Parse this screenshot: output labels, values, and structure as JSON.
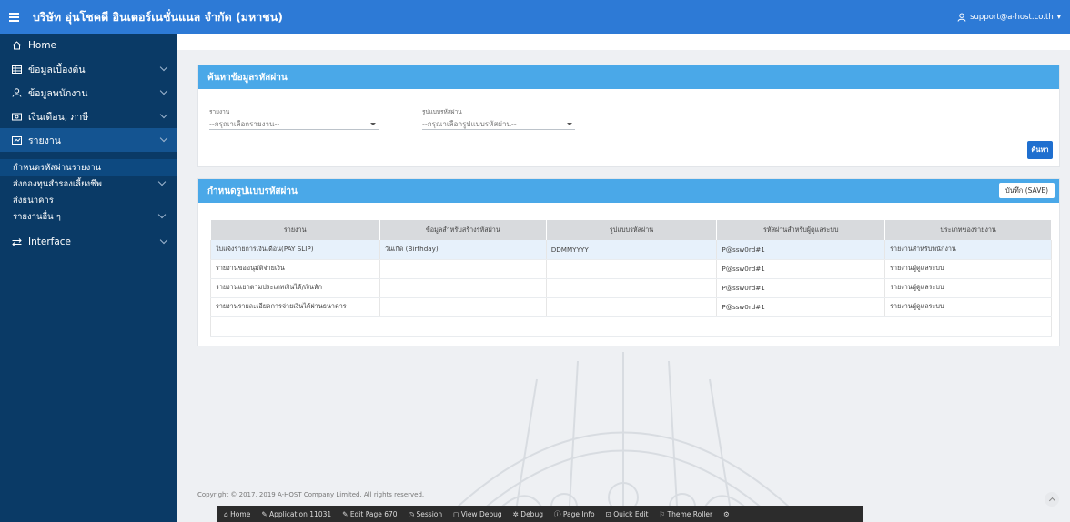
{
  "header": {
    "title": "บริษัท อุ่นโชคดี อินเตอร์เนชั่นแนล จำกัด (มหาชน)",
    "user": "support@a-host.co.th",
    "color": "#2d7ad6"
  },
  "sidebar": {
    "items": [
      {
        "label": "Home",
        "icon": "home-icon"
      },
      {
        "label": "ข้อมูลเบื้องต้น",
        "icon": "table-icon"
      },
      {
        "label": "ข้อมูลพนักงาน",
        "icon": "user-icon"
      },
      {
        "label": "เงินเดือน, ภาษี",
        "icon": "money-icon"
      },
      {
        "label": "รายงาน",
        "icon": "report-icon"
      },
      {
        "label": "Interface",
        "icon": "swap-icon"
      }
    ],
    "subitems": [
      {
        "label": "กำหนดรหัสผ่านรายงาน"
      },
      {
        "label": "ส่งกองทุนสำรองเลี้ยงชีพ"
      },
      {
        "label": "ส่งธนาคาร"
      },
      {
        "label": "รายงานอื่น ๆ"
      }
    ]
  },
  "search_panel": {
    "title": "ค้นหาข้อมูลรหัสผ่าน",
    "report_label": "รายงาน",
    "report_value": "--กรุณาเลือกรายงาน--",
    "format_label": "รูปแบบรหัสผ่าน",
    "format_value": "--กรุณาเลือกรูปแบบรหัสผ่าน--",
    "search_button": "ค้นหา"
  },
  "config_panel": {
    "title": "กำหนดรูปแบบรหัสผ่าน",
    "save_button": "บันทึก (SAVE)",
    "columns": [
      "รายงาน",
      "ข้อมูลสำหรับสร้างรหัสผ่าน",
      "รูปแบบรหัสผ่าน",
      "รหัสผ่านสำหรับผู้ดูแลระบบ",
      "ประเภทของรายงาน"
    ],
    "rows": [
      [
        "ใบแจ้งรายการเงินเดือน(PAY SLIP)",
        "วันเกิด (Birthday)",
        "DDMMYYYY",
        "P@ssw0rd#1",
        "รายงานสำหรับพนักงาน"
      ],
      [
        "รายงานขออนุมัติจ่ายเงิน",
        "",
        "",
        "P@ssw0rd#1",
        "รายงานผู้ดูแลระบบ"
      ],
      [
        "รายงานแยกตามประเภทเงินได้/เงินหัก",
        "",
        "",
        "P@ssw0rd#1",
        "รายงานผู้ดูแลระบบ"
      ],
      [
        "รายงานรายละเอียดการจ่ายเงินได้ผ่านธนาคาร",
        "",
        "",
        "P@ssw0rd#1",
        "รายงานผู้ดูแลระบบ"
      ]
    ]
  },
  "footer": {
    "copyright": "Copyright © 2017, 2019 A-HOST Company Limited. All rights reserved.",
    "devbar": [
      "Home",
      "Application 11031",
      "Edit Page 670",
      "Session",
      "View Debug",
      "Debug",
      "Page Info",
      "Quick Edit",
      "Theme Roller"
    ]
  }
}
